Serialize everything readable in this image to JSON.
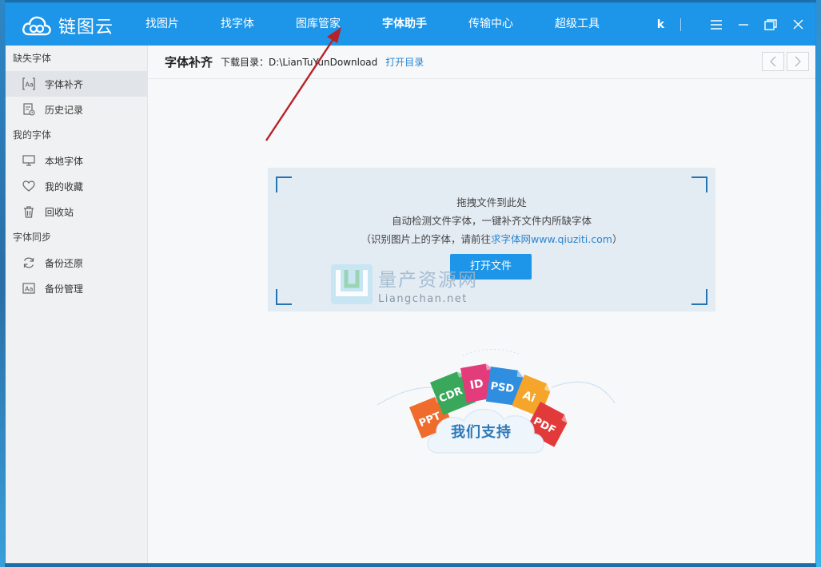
{
  "app": {
    "name": "链图云",
    "user": "k"
  },
  "nav": [
    {
      "label": "找图片"
    },
    {
      "label": "找字体"
    },
    {
      "label": "图库管家"
    },
    {
      "label": "字体助手",
      "active": true
    },
    {
      "label": "传输中心"
    },
    {
      "label": "超级工具"
    }
  ],
  "sidebar": {
    "sections": [
      {
        "title": "缺失字体",
        "items": [
          {
            "label": "字体补齐",
            "icon": "font-aa-icon",
            "active": true
          },
          {
            "label": "历史记录",
            "icon": "history-doc-icon"
          }
        ]
      },
      {
        "title": "我的字体",
        "items": [
          {
            "label": "本地字体",
            "icon": "monitor-icon"
          },
          {
            "label": "我的收藏",
            "icon": "heart-icon"
          },
          {
            "label": "回收站",
            "icon": "trash-icon"
          }
        ]
      },
      {
        "title": "字体同步",
        "items": [
          {
            "label": "备份还原",
            "icon": "refresh-icon"
          },
          {
            "label": "备份管理",
            "icon": "font-aa-box-icon"
          }
        ]
      }
    ]
  },
  "toolbar": {
    "title": "字体补齐",
    "dir_label": "下载目录：",
    "dir_path": "D:\\LianTuYunDownload",
    "open_dir": "打开目录"
  },
  "dropzone": {
    "line1": "拖拽文件到此处",
    "line2": "自动检测文件字体，一键补齐文件内所缺字体",
    "line3_prefix": "（识别图片上的字体，请前往",
    "line3_link": "求字体网www.qiuziti.com",
    "line3_suffix": "）",
    "button": "打开文件"
  },
  "watermark": {
    "cn": "量产资源网",
    "en": "Liangchan.net"
  },
  "support": {
    "label": "我们支持",
    "formats": [
      "PPT",
      "CDR",
      "ID",
      "PSD",
      "Ai",
      "PDF"
    ]
  },
  "colors": {
    "brand": "#1d95e8",
    "link": "#2a86d1"
  }
}
